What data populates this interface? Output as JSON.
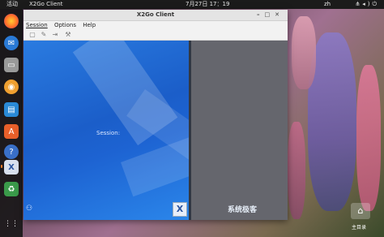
{
  "topbar": {
    "activities": "活动",
    "app_name": "X2Go Client",
    "clock": "7月27日  17：19",
    "lang": "zh",
    "tray_icons": [
      "network-icon",
      "volume-icon",
      "power-icon"
    ]
  },
  "dock": {
    "items": [
      "firefox-icon",
      "thunderbird-icon",
      "files-icon",
      "rhythmbox-icon",
      "libreoffice-writer-icon",
      "app-center-icon",
      "help-icon",
      "x2go-icon",
      "trash-icon",
      "show-apps-icon"
    ]
  },
  "window": {
    "title": "X2Go Client",
    "menu": [
      "Session",
      "Options",
      "Help"
    ],
    "toolbar": [
      "new-session-icon",
      "edit-session-icon",
      "export-session-icon",
      "preferences-icon"
    ],
    "session_label": "Session:",
    "logo_text": "X"
  },
  "desktop": {
    "watermark": "系统极客",
    "home_label": "主目录"
  },
  "colors": {
    "session_blue": "#1d63d2",
    "side_panel": "#65666d",
    "topbar": "#1b1b1b"
  }
}
